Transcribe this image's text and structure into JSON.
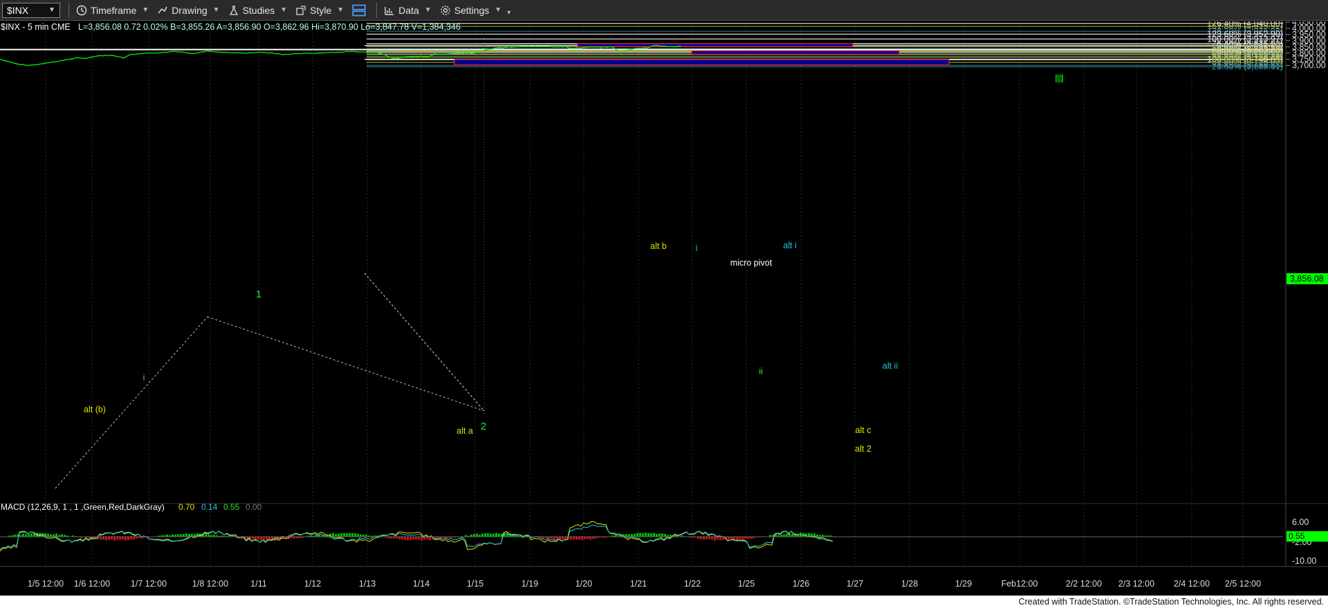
{
  "toolbar": {
    "symbol": "$INX",
    "timeframe": "Timeframe",
    "drawing": "Drawing",
    "studies": "Studies",
    "style": "Style",
    "data": "Data",
    "settings": "Settings"
  },
  "header": {
    "symbol_info": "$INX - 5 min  CME",
    "quote": "L=3,856.08  0.72  0.02%  B=3,855.26  A=3,856.90  O=3,862.96  Hi=3,870.90  Lo=3,847.78  V=1,384,346",
    "macd_label": "MACD (12,26,9, 1 , 1 ,Green,Red,DarkGray)",
    "macd_values": [
      "0.70",
      "0.14",
      "0.55",
      "0.00"
    ]
  },
  "footer": "Created with TradeStation. ©TradeStation Technologies, Inc. All rights reserved.",
  "colors": {
    "price": "#00ff00",
    "box_fill": "#00008b",
    "box_border": "#ff3030",
    "fib_white": "#d8d8d8",
    "fib_yellow": "#b8b84a",
    "fib_cyan": "#3a8a9a",
    "label_yellow": "#e0e000",
    "label_cyan": "#20c8e0",
    "label_green": "#30e030"
  },
  "chart_data": {
    "type": "line",
    "y_ticks": [
      "4,050.00",
      "4,000.00",
      "3,950.00",
      "3,900.00",
      "3,850.00",
      "3,800.00",
      "3,750.00",
      "3,700.00"
    ],
    "x_ticks": [
      "1/5 12:00",
      "1/6 12:00",
      "1/7 12:00",
      "1/8 12:00",
      "1/11",
      "1/12",
      "1/13",
      "1/14",
      "1/15",
      "1/19",
      "1/20",
      "1/21",
      "1/22",
      "1/25",
      "1/26",
      "1/27",
      "1/28",
      "1/29",
      "Feb12:00",
      "2/2 12:00",
      "2/3 12:00",
      "2/4 12:00",
      "2/5 12:00"
    ],
    "last_price": "3,856.08",
    "fib_levels": [
      {
        "label": "176.40% (4,040.00)",
        "value": 4040.0,
        "color": "white"
      },
      {
        "label": "161.80% (4,015.92)",
        "value": 4015.92,
        "color": "yellow"
      },
      {
        "label": "138.20% (3,976.98)",
        "value": 3976.98,
        "color": "cyan"
      },
      {
        "label": "123.60% (3,952.90)",
        "value": 3952.9,
        "color": "white"
      },
      {
        "label": "100.00% (3,913.97)",
        "value": 3913.97,
        "color": "white"
      },
      {
        "label": "76.40% (3,875.03)",
        "value": 3875.03,
        "color": "white"
      },
      {
        "label": "0.00% (3,861.19)",
        "value": 3861.19,
        "color": "white"
      },
      {
        "label": "61.80% (3,850.95)",
        "value": 3850.95,
        "color": "yellow"
      },
      {
        "label": "23.60% (3,834.44)",
        "value": 3834.44,
        "color": "cyan"
      },
      {
        "label": "0.00% (3,828.30)",
        "value": 3828.3,
        "color": "white"
      },
      {
        "label": "38.20% (3,817.89)",
        "value": 3817.89,
        "color": "yellow"
      },
      {
        "label": "38.20% (3,812.82)",
        "value": 3812.82,
        "color": "yellow"
      },
      {
        "label": "50.00% (3,804.52)",
        "value": 3804.52,
        "color": "white"
      },
      {
        "label": "61.80% (3,791.14)",
        "value": 3791.14,
        "color": "yellow"
      },
      {
        "label": "61.80% (3,788.38)",
        "value": 3788.38,
        "color": "yellow"
      },
      {
        "label": "76.40% (3,774.60)",
        "value": 3774.6,
        "color": "cyan"
      },
      {
        "label": "38.20% (3,764.49)",
        "value": 3764.49,
        "color": "yellow"
      },
      {
        "label": "100.00% (3,749.05)",
        "value": 3749.05,
        "color": "white"
      },
      {
        "label": "50.00% (3,744.35)",
        "value": 3744.35,
        "color": "yellow"
      },
      {
        "label": "61.80% (3,725.07)",
        "value": 3725.07,
        "color": "yellow"
      },
      {
        "label": "76.40% (3,700.68)",
        "value": 3700.68,
        "color": "cyan"
      },
      {
        "label": "23.60% (3,688.61)",
        "value": 3688.61,
        "color": "cyan"
      }
    ],
    "wave_labels": [
      {
        "text": "alt (b)",
        "color": "yellow"
      },
      {
        "text": "i",
        "color": "green"
      },
      {
        "text": "1",
        "color": "green"
      },
      {
        "text": "alt a",
        "color": "yellow"
      },
      {
        "text": "2",
        "color": "green"
      },
      {
        "text": "alt b",
        "color": "yellow"
      },
      {
        "text": "i",
        "color": "green"
      },
      {
        "text": "micro pivot",
        "color": "white"
      },
      {
        "text": "alt i",
        "color": "cyan"
      },
      {
        "text": "ii",
        "color": "green"
      },
      {
        "text": "alt ii",
        "color": "cyan"
      },
      {
        "text": "alt c",
        "color": "yellow"
      },
      {
        "text": "alt 2",
        "color": "yellow"
      }
    ],
    "price_path": [
      [
        0,
        3750
      ],
      [
        12,
        3732
      ],
      [
        25,
        3712
      ],
      [
        40,
        3700
      ],
      [
        55,
        3708
      ],
      [
        70,
        3722
      ],
      [
        85,
        3735
      ],
      [
        95,
        3744
      ],
      [
        110,
        3760
      ],
      [
        125,
        3758
      ],
      [
        140,
        3776
      ],
      [
        158,
        3782
      ],
      [
        170,
        3775
      ],
      [
        178,
        3760
      ],
      [
        188,
        3788
      ],
      [
        205,
        3797
      ],
      [
        225,
        3802
      ],
      [
        240,
        3806
      ],
      [
        250,
        3812
      ],
      [
        262,
        3808
      ],
      [
        272,
        3800
      ],
      [
        280,
        3795
      ],
      [
        290,
        3806
      ],
      [
        300,
        3818
      ],
      [
        310,
        3811
      ],
      [
        320,
        3806
      ],
      [
        335,
        3804
      ],
      [
        355,
        3800
      ],
      [
        375,
        3806
      ],
      [
        395,
        3799
      ],
      [
        410,
        3787
      ],
      [
        425,
        3794
      ],
      [
        440,
        3798
      ],
      [
        460,
        3799
      ],
      [
        475,
        3805
      ],
      [
        492,
        3808
      ],
      [
        505,
        3812
      ],
      [
        518,
        3810
      ],
      [
        530,
        3808
      ],
      [
        545,
        3803
      ],
      [
        556,
        3790
      ],
      [
        565,
        3762
      ],
      [
        572,
        3754
      ],
      [
        582,
        3765
      ],
      [
        595,
        3772
      ],
      [
        608,
        3775
      ],
      [
        620,
        3772
      ],
      [
        628,
        3792
      ],
      [
        640,
        3787
      ],
      [
        655,
        3796
      ],
      [
        670,
        3800
      ],
      [
        688,
        3800
      ],
      [
        695,
        3822
      ],
      [
        710,
        3834
      ],
      [
        722,
        3842
      ],
      [
        740,
        3848
      ],
      [
        760,
        3854
      ],
      [
        775,
        3852
      ],
      [
        790,
        3855
      ],
      [
        805,
        3850
      ],
      [
        818,
        3852
      ],
      [
        825,
        3836
      ],
      [
        840,
        3843
      ],
      [
        855,
        3848
      ],
      [
        870,
        3846
      ],
      [
        885,
        3850
      ],
      [
        892,
        3825
      ],
      [
        898,
        3800
      ],
      [
        905,
        3822
      ],
      [
        915,
        3834
      ],
      [
        928,
        3842
      ],
      [
        938,
        3844
      ],
      [
        946,
        3864
      ],
      [
        955,
        3858
      ],
      [
        965,
        3853
      ],
      [
        975,
        3851
      ],
      [
        985,
        3855
      ]
    ],
    "macd_ticks": [
      "6.00",
      "-2.00",
      "-10.00"
    ],
    "macd_last": "0.55"
  }
}
